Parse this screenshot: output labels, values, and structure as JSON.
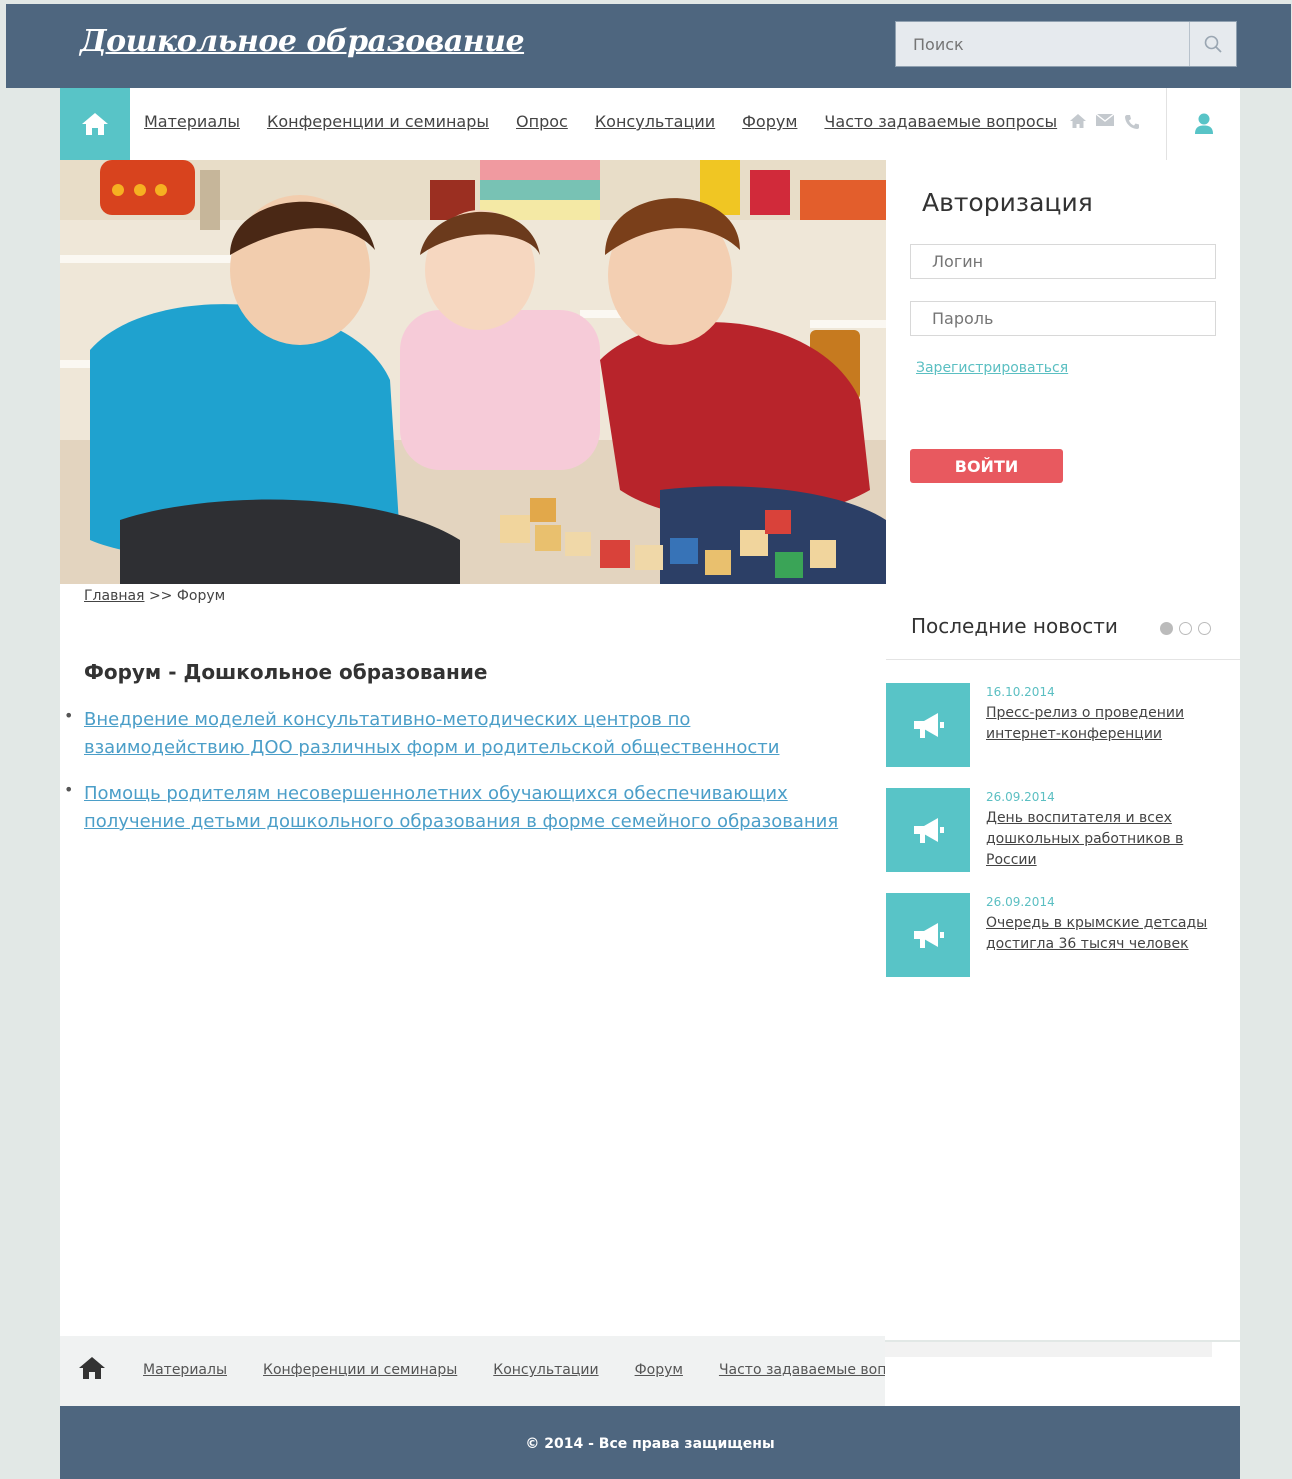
{
  "header": {
    "logo": "Дошкольное образование",
    "search_placeholder": "Поиск"
  },
  "nav": {
    "items": [
      {
        "label": "Материалы"
      },
      {
        "label": "Конференции и семинары"
      },
      {
        "label": "Опрос"
      },
      {
        "label": "Консультации"
      },
      {
        "label": "Форум"
      },
      {
        "label": "Часто задаваемые вопросы"
      }
    ],
    "icons": [
      "home-icon",
      "mail-icon",
      "phone-icon",
      "user-icon"
    ]
  },
  "auth": {
    "title": "Авторизация",
    "login_placeholder": "Логин",
    "password_placeholder": "Пароль",
    "register_link": "Зарегистрироваться",
    "login_button": "ВОЙТИ"
  },
  "breadcrumb": {
    "home": "Главная",
    "separator": ">>",
    "current": "Форум"
  },
  "forum": {
    "title": "Форум - Дошкольное образование",
    "topics": [
      {
        "label": "Внедрение моделей консультативно-методических центров по взаимодействию ДОО различных форм и родительской общественности"
      },
      {
        "label": "Помощь родителям несовершеннолетних обучающихся обеспечивающих получение детьми дошкольного образования в форме семейного образования"
      }
    ]
  },
  "news": {
    "title": "Последние новости",
    "items": [
      {
        "date": "16.10.2014",
        "title": "Пресс-релиз о проведении интернет-конференции"
      },
      {
        "date": "26.09.2014",
        "title": "День воспитателя и всех дошкольных работников в России"
      },
      {
        "date": "26.09.2014",
        "title": "Очередь в крымские детсады достигла 36 тысяч человек"
      }
    ]
  },
  "footer_nav": {
    "items": [
      {
        "label": "Материалы"
      },
      {
        "label": "Конференции и семинары"
      },
      {
        "label": "Консультации"
      },
      {
        "label": "Форум"
      },
      {
        "label": "Часто задаваемые вопросы"
      }
    ]
  },
  "footer": {
    "copyright": "© 2014 - Все права защищены"
  },
  "colors": {
    "header_bg": "#4e667f",
    "accent_teal": "#58c4c7",
    "button_red": "#e8595f",
    "link_blue": "#4b9ec8",
    "page_bg": "#e2e8e6"
  }
}
